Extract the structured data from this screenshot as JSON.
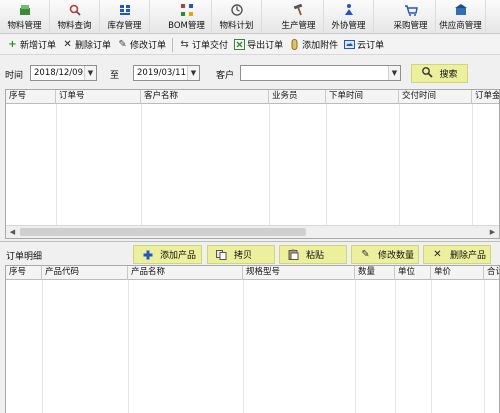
{
  "modules": [
    {
      "label": "物料管理",
      "icon": "materials-icon"
    },
    {
      "label": "物料查询",
      "icon": "search-icon"
    },
    {
      "label": "库存管理",
      "icon": "inventory-icon"
    },
    {
      "label": "BOM管理",
      "icon": "bom-icon"
    },
    {
      "label": "物料计划",
      "icon": "plan-icon"
    },
    {
      "label": "生产管理",
      "icon": "hammer-icon"
    },
    {
      "label": "外协管理",
      "icon": "outsource-icon"
    },
    {
      "label": "采购管理",
      "icon": "purchase-icon"
    },
    {
      "label": "供应商管理",
      "icon": "supplier-icon"
    }
  ],
  "actions": {
    "add_order": "新增订单",
    "delete_order": "删除订单",
    "edit_order": "修改订单",
    "deliver_order": "订单交付",
    "export_order": "导出订单",
    "add_attachment": "添加附件",
    "cloud_order": "云订单"
  },
  "filter": {
    "time_label": "时间",
    "date_from": "2018/12/09",
    "to_label": "至",
    "date_to": "2019/03/11",
    "customer_label": "客户",
    "customer_value": "",
    "search_label": "搜索"
  },
  "order_table": {
    "columns": [
      "序号",
      "订单号",
      "客户名称",
      "业务员",
      "下单时间",
      "交付时间",
      "订单金额"
    ]
  },
  "detail": {
    "title": "订单明细",
    "buttons": {
      "add_product": "添加产品",
      "copy": "拷贝",
      "paste": "粘贴",
      "edit_qty": "修改数量",
      "delete_product": "删除产品"
    },
    "columns": [
      "序号",
      "产品代码",
      "产品名称",
      "规格型号",
      "数量",
      "单位",
      "单价",
      "合计"
    ]
  },
  "colors": {
    "button_bg": "#ecef9c",
    "accent_green": "#2e8b2e",
    "accent_red": "#cc2222",
    "accent_blue": "#2255cc"
  }
}
